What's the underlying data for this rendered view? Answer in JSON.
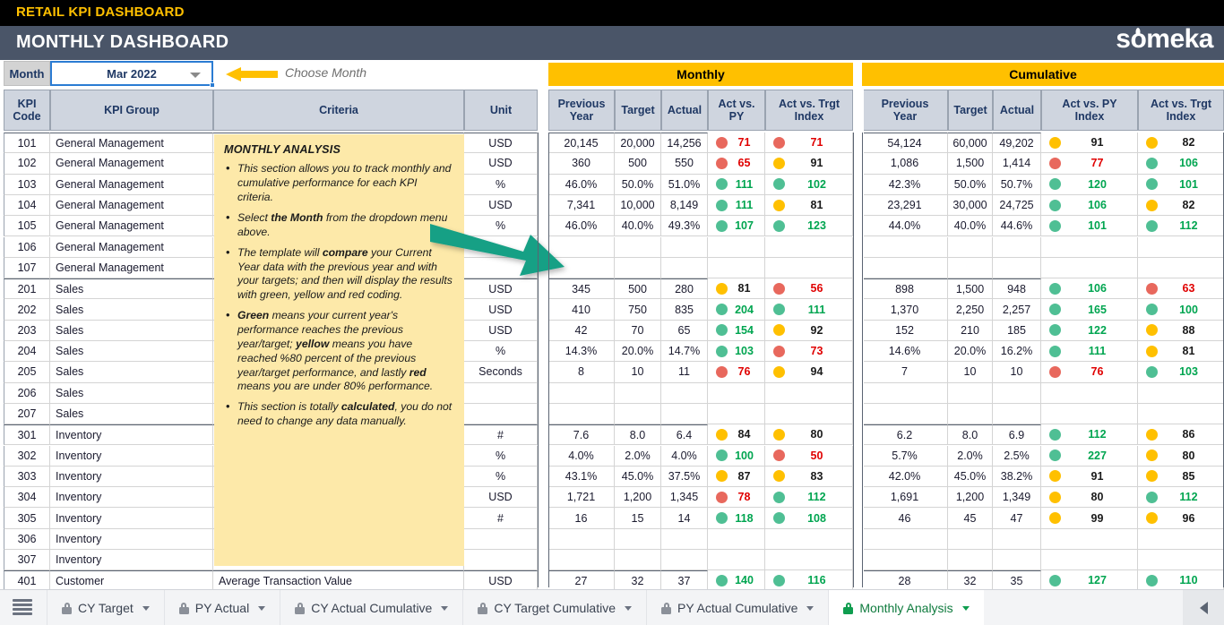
{
  "window": {
    "top_strip_title": "RETAIL KPI DASHBOARD",
    "banner_title": "MONTHLY DASHBOARD",
    "logo_text_1": "s",
    "logo_text_2": "o",
    "logo_text_3": "meka"
  },
  "colors": {
    "accent_yellow": "#FFC000",
    "banner": "#4A5568",
    "green": "#4FBF94",
    "red": "#E8685D",
    "note_bg": "#FDE9A9",
    "teal_arrow": "#16A085"
  },
  "month_selector": {
    "label": "Month",
    "value": "Mar 2022",
    "hint": "Choose Month",
    "caret_icon": "chevron-down-icon"
  },
  "section_headers": {
    "monthly": "Monthly",
    "cumulative": "Cumulative"
  },
  "headers": {
    "kpi_code": "KPI\nCode",
    "kpi_code_l1": "KPI",
    "kpi_code_l2": "Code",
    "kpi_group": "KPI Group",
    "criteria": "Criteria",
    "unit": "Unit",
    "m_prev_l1": "Previous",
    "m_prev_l2": "Year",
    "m_target": "Target",
    "m_actual": "Actual",
    "m_apy_l1": "Act vs.",
    "m_apy_l2": "PY",
    "m_atg_l1": "Act vs. Trgt",
    "m_atg_l2": "Index",
    "c_prev_l1": "Previous",
    "c_prev_l2": "Year",
    "c_target": "Target",
    "c_actual": "Actual",
    "c_apy_l1": "Act vs. PY",
    "c_apy_l2": "Index",
    "c_atg_l1": "Act vs. Trgt",
    "c_atg_l2": "Index"
  },
  "note": {
    "title": "MONTHLY ANALYSIS",
    "b1": "This section allows you to track monthly and cumulative performance for each KPI criteria.",
    "b2_a": "Select ",
    "b2_b": "the Month",
    "b2_c": " from the dropdown menu above.",
    "b3_a": "The template will ",
    "b3_b": "compare",
    "b3_c": " your Current Year data with the previous year and with your targets; and then will display the results with green, yellow and red coding.",
    "b4_a": "Green",
    "b4_b": " means your current year's performance reaches the previous year/target; ",
    "b4_c": "yellow",
    "b4_d": " means you have reached %80 percent of the previous year/target performance, and lastly ",
    "b4_e": "red",
    "b4_f": " means you are under 80% performance.",
    "b5_a": "This section is totally ",
    "b5_b": "calculated",
    "b5_c": ", you do not need to change any data manually."
  },
  "rows": [
    {
      "code": "101",
      "group": "General Management",
      "criteria": "",
      "unit": "USD",
      "m": {
        "py": "20,145",
        "tg": "20,000",
        "ac": "14,256",
        "apy": {
          "c": "red",
          "v": "71"
        },
        "atg": {
          "c": "red",
          "v": "71"
        }
      },
      "c": {
        "py": "54,124",
        "tg": "60,000",
        "ac": "49,202",
        "apy": {
          "c": "yellow",
          "v": "91"
        },
        "atg": {
          "c": "yellow",
          "v": "82"
        }
      },
      "groupstart": true
    },
    {
      "code": "102",
      "group": "General Management",
      "criteria": "",
      "unit": "USD",
      "m": {
        "py": "360",
        "tg": "500",
        "ac": "550",
        "apy": {
          "c": "red",
          "v": "65"
        },
        "atg": {
          "c": "yellow",
          "v": "91"
        }
      },
      "c": {
        "py": "1,086",
        "tg": "1,500",
        "ac": "1,414",
        "apy": {
          "c": "red",
          "v": "77"
        },
        "atg": {
          "c": "green",
          "v": "106"
        }
      }
    },
    {
      "code": "103",
      "group": "General Management",
      "criteria": "",
      "unit": "%",
      "m": {
        "py": "46.0%",
        "tg": "50.0%",
        "ac": "51.0%",
        "apy": {
          "c": "green",
          "v": "111"
        },
        "atg": {
          "c": "green",
          "v": "102"
        }
      },
      "c": {
        "py": "42.3%",
        "tg": "50.0%",
        "ac": "50.7%",
        "apy": {
          "c": "green",
          "v": "120"
        },
        "atg": {
          "c": "green",
          "v": "101"
        }
      }
    },
    {
      "code": "104",
      "group": "General Management",
      "criteria": "",
      "unit": "USD",
      "m": {
        "py": "7,341",
        "tg": "10,000",
        "ac": "8,149",
        "apy": {
          "c": "green",
          "v": "111"
        },
        "atg": {
          "c": "yellow",
          "v": "81"
        }
      },
      "c": {
        "py": "23,291",
        "tg": "30,000",
        "ac": "24,725",
        "apy": {
          "c": "green",
          "v": "106"
        },
        "atg": {
          "c": "yellow",
          "v": "82"
        }
      }
    },
    {
      "code": "105",
      "group": "General Management",
      "criteria": "",
      "unit": "%",
      "m": {
        "py": "46.0%",
        "tg": "40.0%",
        "ac": "49.3%",
        "apy": {
          "c": "green",
          "v": "107"
        },
        "atg": {
          "c": "green",
          "v": "123"
        }
      },
      "c": {
        "py": "44.0%",
        "tg": "40.0%",
        "ac": "44.6%",
        "apy": {
          "c": "green",
          "v": "101"
        },
        "atg": {
          "c": "green",
          "v": "112"
        }
      }
    },
    {
      "code": "106",
      "group": "General Management",
      "criteria": "",
      "unit": "",
      "m": {
        "py": "",
        "tg": "",
        "ac": "",
        "apy": {
          "c": "",
          "v": ""
        },
        "atg": {
          "c": "",
          "v": ""
        }
      },
      "c": {
        "py": "",
        "tg": "",
        "ac": "",
        "apy": {
          "c": "",
          "v": ""
        },
        "atg": {
          "c": "",
          "v": ""
        }
      }
    },
    {
      "code": "107",
      "group": "General Management",
      "criteria": "",
      "unit": "",
      "m": {
        "py": "",
        "tg": "",
        "ac": "",
        "apy": {
          "c": "",
          "v": ""
        },
        "atg": {
          "c": "",
          "v": ""
        }
      },
      "c": {
        "py": "",
        "tg": "",
        "ac": "",
        "apy": {
          "c": "",
          "v": ""
        },
        "atg": {
          "c": "",
          "v": ""
        }
      }
    },
    {
      "code": "201",
      "group": "Sales",
      "criteria": "",
      "unit": "USD",
      "m": {
        "py": "345",
        "tg": "500",
        "ac": "280",
        "apy": {
          "c": "yellow",
          "v": "81"
        },
        "atg": {
          "c": "red",
          "v": "56"
        }
      },
      "c": {
        "py": "898",
        "tg": "1,500",
        "ac": "948",
        "apy": {
          "c": "green",
          "v": "106"
        },
        "atg": {
          "c": "red",
          "v": "63"
        }
      },
      "groupstart": true
    },
    {
      "code": "202",
      "group": "Sales",
      "criteria": "",
      "unit": "USD",
      "m": {
        "py": "410",
        "tg": "750",
        "ac": "835",
        "apy": {
          "c": "green",
          "v": "204"
        },
        "atg": {
          "c": "green",
          "v": "111"
        }
      },
      "c": {
        "py": "1,370",
        "tg": "2,250",
        "ac": "2,257",
        "apy": {
          "c": "green",
          "v": "165"
        },
        "atg": {
          "c": "green",
          "v": "100"
        }
      }
    },
    {
      "code": "203",
      "group": "Sales",
      "criteria": "",
      "unit": "USD",
      "m": {
        "py": "42",
        "tg": "70",
        "ac": "65",
        "apy": {
          "c": "green",
          "v": "154"
        },
        "atg": {
          "c": "yellow",
          "v": "92"
        }
      },
      "c": {
        "py": "152",
        "tg": "210",
        "ac": "185",
        "apy": {
          "c": "green",
          "v": "122"
        },
        "atg": {
          "c": "yellow",
          "v": "88"
        }
      }
    },
    {
      "code": "204",
      "group": "Sales",
      "criteria": "",
      "unit": "%",
      "m": {
        "py": "14.3%",
        "tg": "20.0%",
        "ac": "14.7%",
        "apy": {
          "c": "green",
          "v": "103"
        },
        "atg": {
          "c": "red",
          "v": "73"
        }
      },
      "c": {
        "py": "14.6%",
        "tg": "20.0%",
        "ac": "16.2%",
        "apy": {
          "c": "green",
          "v": "111"
        },
        "atg": {
          "c": "yellow",
          "v": "81"
        }
      }
    },
    {
      "code": "205",
      "group": "Sales",
      "criteria": "",
      "unit": "Seconds",
      "m": {
        "py": "8",
        "tg": "10",
        "ac": "11",
        "apy": {
          "c": "red",
          "v": "76"
        },
        "atg": {
          "c": "yellow",
          "v": "94"
        }
      },
      "c": {
        "py": "7",
        "tg": "10",
        "ac": "10",
        "apy": {
          "c": "red",
          "v": "76"
        },
        "atg": {
          "c": "green",
          "v": "103"
        }
      }
    },
    {
      "code": "206",
      "group": "Sales",
      "criteria": "",
      "unit": "",
      "m": {
        "py": "",
        "tg": "",
        "ac": "",
        "apy": {
          "c": "",
          "v": ""
        },
        "atg": {
          "c": "",
          "v": ""
        }
      },
      "c": {
        "py": "",
        "tg": "",
        "ac": "",
        "apy": {
          "c": "",
          "v": ""
        },
        "atg": {
          "c": "",
          "v": ""
        }
      }
    },
    {
      "code": "207",
      "group": "Sales",
      "criteria": "",
      "unit": "",
      "m": {
        "py": "",
        "tg": "",
        "ac": "",
        "apy": {
          "c": "",
          "v": ""
        },
        "atg": {
          "c": "",
          "v": ""
        }
      },
      "c": {
        "py": "",
        "tg": "",
        "ac": "",
        "apy": {
          "c": "",
          "v": ""
        },
        "atg": {
          "c": "",
          "v": ""
        }
      }
    },
    {
      "code": "301",
      "group": "Inventory",
      "criteria": "",
      "unit": "#",
      "m": {
        "py": "7.6",
        "tg": "8.0",
        "ac": "6.4",
        "apy": {
          "c": "yellow",
          "v": "84"
        },
        "atg": {
          "c": "yellow",
          "v": "80"
        }
      },
      "c": {
        "py": "6.2",
        "tg": "8.0",
        "ac": "6.9",
        "apy": {
          "c": "green",
          "v": "112"
        },
        "atg": {
          "c": "yellow",
          "v": "86"
        }
      },
      "groupstart": true
    },
    {
      "code": "302",
      "group": "Inventory",
      "criteria": "",
      "unit": "%",
      "m": {
        "py": "4.0%",
        "tg": "2.0%",
        "ac": "4.0%",
        "apy": {
          "c": "green",
          "v": "100"
        },
        "atg": {
          "c": "red",
          "v": "50"
        }
      },
      "c": {
        "py": "5.7%",
        "tg": "2.0%",
        "ac": "2.5%",
        "apy": {
          "c": "green",
          "v": "227"
        },
        "atg": {
          "c": "yellow",
          "v": "80"
        }
      }
    },
    {
      "code": "303",
      "group": "Inventory",
      "criteria": "",
      "unit": "%",
      "m": {
        "py": "43.1%",
        "tg": "45.0%",
        "ac": "37.5%",
        "apy": {
          "c": "yellow",
          "v": "87"
        },
        "atg": {
          "c": "yellow",
          "v": "83"
        }
      },
      "c": {
        "py": "42.0%",
        "tg": "45.0%",
        "ac": "38.2%",
        "apy": {
          "c": "yellow",
          "v": "91"
        },
        "atg": {
          "c": "yellow",
          "v": "85"
        }
      }
    },
    {
      "code": "304",
      "group": "Inventory",
      "criteria": "",
      "unit": "USD",
      "m": {
        "py": "1,721",
        "tg": "1,200",
        "ac": "1,345",
        "apy": {
          "c": "red",
          "v": "78"
        },
        "atg": {
          "c": "green",
          "v": "112"
        }
      },
      "c": {
        "py": "1,691",
        "tg": "1,200",
        "ac": "1,349",
        "apy": {
          "c": "yellow",
          "v": "80"
        },
        "atg": {
          "c": "green",
          "v": "112"
        }
      }
    },
    {
      "code": "305",
      "group": "Inventory",
      "criteria": "",
      "unit": "#",
      "m": {
        "py": "16",
        "tg": "15",
        "ac": "14",
        "apy": {
          "c": "green",
          "v": "118"
        },
        "atg": {
          "c": "green",
          "v": "108"
        }
      },
      "c": {
        "py": "46",
        "tg": "45",
        "ac": "47",
        "apy": {
          "c": "yellow",
          "v": "99"
        },
        "atg": {
          "c": "yellow",
          "v": "96"
        }
      }
    },
    {
      "code": "306",
      "group": "Inventory",
      "criteria": "",
      "unit": "",
      "m": {
        "py": "",
        "tg": "",
        "ac": "",
        "apy": {
          "c": "",
          "v": ""
        },
        "atg": {
          "c": "",
          "v": ""
        }
      },
      "c": {
        "py": "",
        "tg": "",
        "ac": "",
        "apy": {
          "c": "",
          "v": ""
        },
        "atg": {
          "c": "",
          "v": ""
        }
      }
    },
    {
      "code": "307",
      "group": "Inventory",
      "criteria": "",
      "unit": "",
      "m": {
        "py": "",
        "tg": "",
        "ac": "",
        "apy": {
          "c": "",
          "v": ""
        },
        "atg": {
          "c": "",
          "v": ""
        }
      },
      "c": {
        "py": "",
        "tg": "",
        "ac": "",
        "apy": {
          "c": "",
          "v": ""
        },
        "atg": {
          "c": "",
          "v": ""
        }
      }
    },
    {
      "code": "401",
      "group": "Customer",
      "criteria": "Average Transaction Value",
      "unit": "USD",
      "m": {
        "py": "27",
        "tg": "32",
        "ac": "37",
        "apy": {
          "c": "green",
          "v": "140"
        },
        "atg": {
          "c": "green",
          "v": "116"
        }
      },
      "c": {
        "py": "28",
        "tg": "32",
        "ac": "35",
        "apy": {
          "c": "green",
          "v": "127"
        },
        "atg": {
          "c": "green",
          "v": "110"
        }
      },
      "groupstart": true
    }
  ],
  "sheet_tabs": [
    {
      "label": "CY Target",
      "active": false
    },
    {
      "label": "PY Actual",
      "active": false
    },
    {
      "label": "CY Actual Cumulative",
      "active": false
    },
    {
      "label": "CY Target Cumulative",
      "active": false
    },
    {
      "label": "PY Actual Cumulative",
      "active": false
    },
    {
      "label": "Monthly Analysis",
      "active": true
    }
  ],
  "tabbar": {
    "all_sheets_icon": "all-sheets-icon",
    "nav_next_icon": "nav-previous-icon"
  }
}
